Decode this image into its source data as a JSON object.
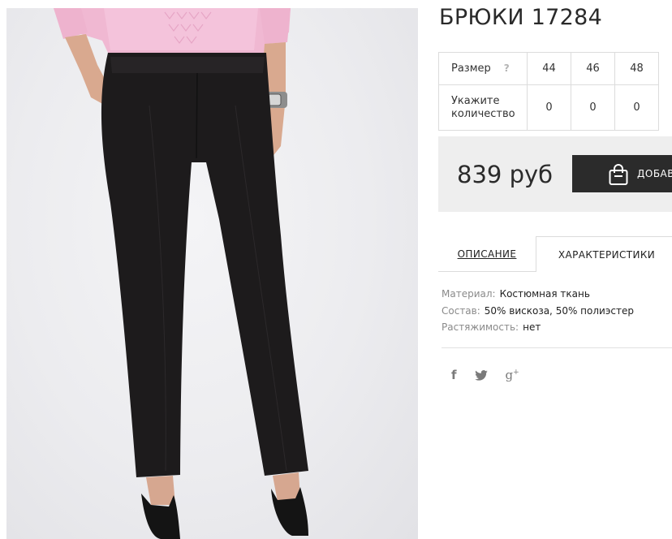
{
  "product": {
    "title": "БРЮКИ 17284",
    "image_icon": "product-photo-black-trousers"
  },
  "size_table": {
    "size_label": "Размер",
    "help_icon": "?",
    "sizes": [
      "44",
      "46",
      "48"
    ],
    "quantity_label": "Укажите количество",
    "quantities": [
      "0",
      "0",
      "0"
    ]
  },
  "buy": {
    "price": "839 руб",
    "add_to_cart_label": "ДОБАВИТЬ В КОРЗИНУ",
    "bag_icon": "shopping-bag-icon"
  },
  "tabs": [
    {
      "label": "ОПИСАНИЕ",
      "active": false
    },
    {
      "label": "ХАРАКТЕРИСТИКИ",
      "active": true
    }
  ],
  "specs": [
    {
      "key": "Материал:",
      "value": "Костюмная ткань"
    },
    {
      "key": "Состав:",
      "value": "50% вискоза, 50% полиэстер"
    },
    {
      "key": "Растяжимость:",
      "value": "нет"
    }
  ],
  "social": {
    "facebook": "f",
    "google_plus": "g",
    "google_plus_sup": "+"
  },
  "colors": {
    "button_bg": "#2b2b2b",
    "price_box_bg": "#eeeeee",
    "border": "#dcdcdc",
    "muted_text": "#8a8a8a"
  }
}
